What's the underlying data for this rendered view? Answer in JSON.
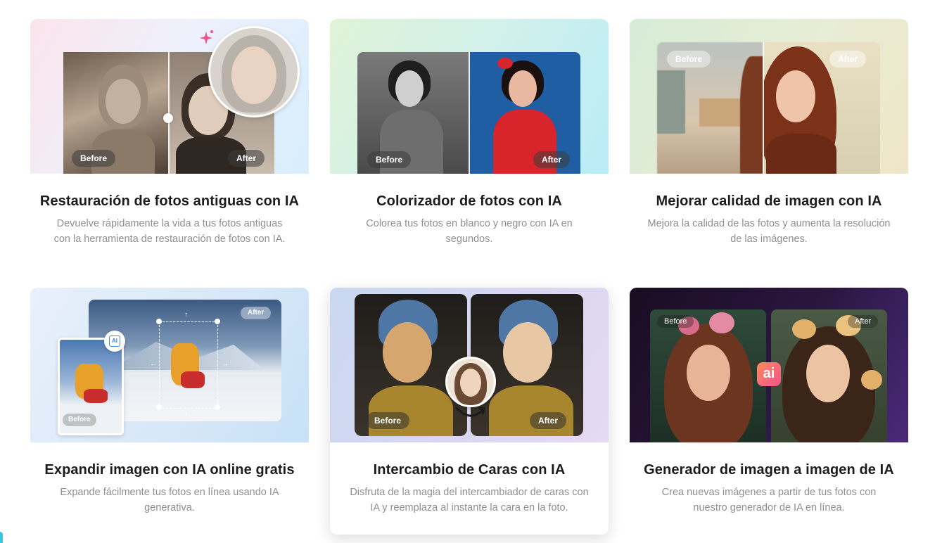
{
  "cards": [
    {
      "title": "Restauración de fotos antiguas con IA",
      "desc": "Devuelve rápidamente la vida a tus fotos antiguas con la herramienta de restauración de fotos con IA.",
      "before": "Before",
      "after": "After"
    },
    {
      "title": "Colorizador de fotos con IA",
      "desc": "Colorea tus fotos en blanco y negro con IA en segundos.",
      "before": "Before",
      "after": "After"
    },
    {
      "title": "Mejorar calidad de imagen con IA",
      "desc": "Mejora la calidad de las fotos y aumenta la resolución de las imágenes.",
      "before": "Before",
      "after": "After"
    },
    {
      "title": "Expandir imagen con IA online gratis",
      "desc": "Expande fácilmente tus fotos en línea usando IA generativa.",
      "before": "Before",
      "after": "After",
      "badge": "AI"
    },
    {
      "title": "Intercambio de Caras con IA",
      "desc": "Disfruta de la magia del intercambiador de caras con IA y reemplaza al instante la cara en la foto.",
      "before": "Before",
      "after": "After"
    },
    {
      "title": "Generador de imagen a imagen de IA",
      "desc": "Crea nuevas imágenes a partir de tus fotos con nuestro generador de IA en línea.",
      "before": "Before",
      "after": "After",
      "badge": "ai"
    }
  ],
  "colors": {
    "title": "#1c1c1c",
    "desc": "#8f8f8f",
    "pill": "#3c3c3c",
    "ai_badge": "#f25a8c"
  }
}
